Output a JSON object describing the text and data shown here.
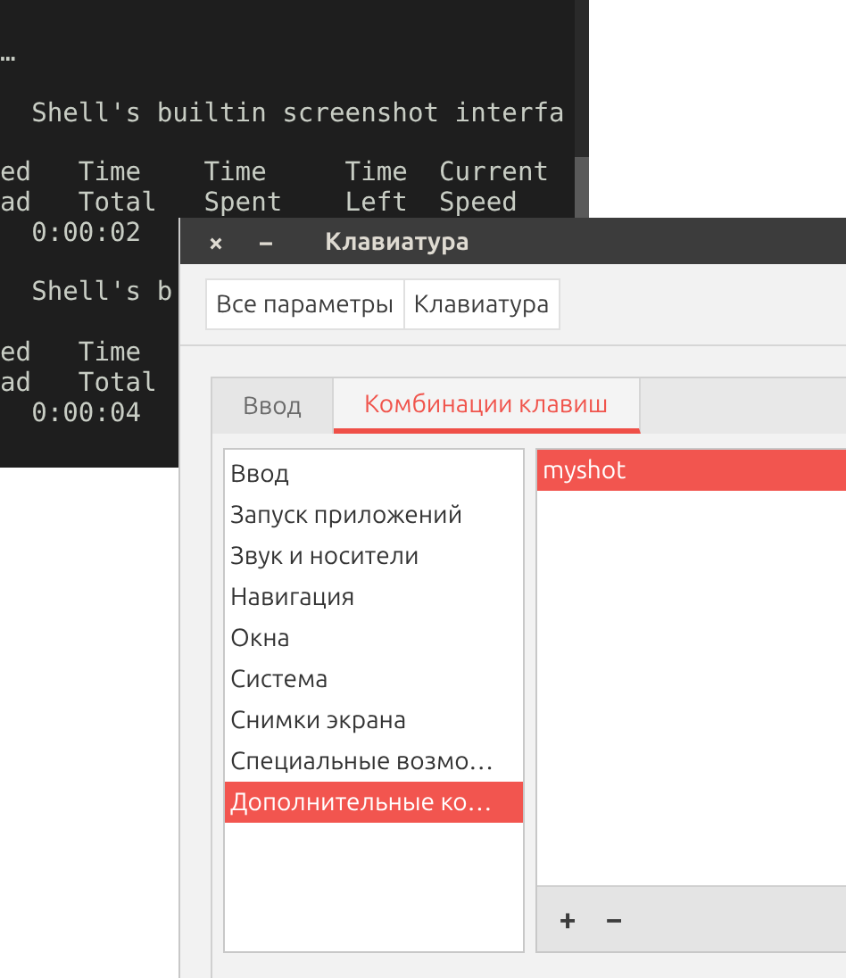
{
  "terminal": {
    "blocks": [
      [
        "…"
      ],
      [
        "  Shell's builtin screenshot interfa"
      ],
      [
        "ed   Time    Time     Time  Current",
        "ad   Total   Spent    Left  Speed",
        "  0:00:02"
      ],
      [
        "  Shell's b"
      ],
      [
        "ed   Time",
        "ad   Total",
        "  0:00:04"
      ]
    ]
  },
  "dialog": {
    "title": "Клавиатура",
    "title_buttons": [
      "×",
      "−"
    ],
    "breadcrumbs": [
      {
        "label": "Все параметры"
      },
      {
        "label": "Клавиатура"
      }
    ],
    "tabs": [
      {
        "label": "Ввод",
        "selected": false
      },
      {
        "label": "Комбинации клавиш",
        "selected": true
      }
    ],
    "categories": [
      {
        "label": "Ввод",
        "selected": false
      },
      {
        "label": "Запуск приложений",
        "selected": false
      },
      {
        "label": "Звук и носители",
        "selected": false
      },
      {
        "label": "Навигация",
        "selected": false
      },
      {
        "label": "Окна",
        "selected": false
      },
      {
        "label": "Система",
        "selected": false
      },
      {
        "label": "Снимки экрана",
        "selected": false
      },
      {
        "label": "Специальные возмо…",
        "selected": false
      },
      {
        "label": "Дополнительные ко…",
        "selected": true
      }
    ],
    "shortcuts": [
      {
        "label": "myshot",
        "selected": true
      }
    ],
    "toolbar_buttons": [
      "+",
      "−"
    ]
  }
}
